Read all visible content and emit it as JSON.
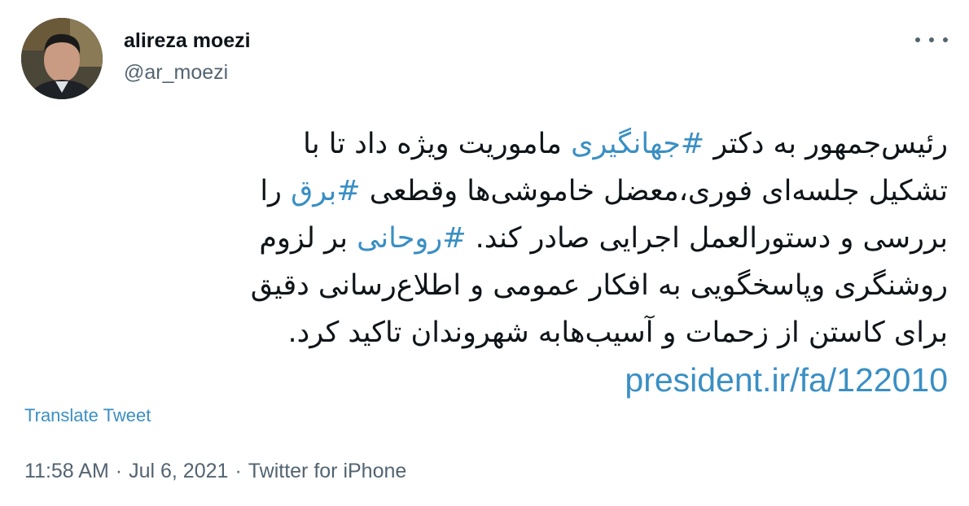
{
  "author": {
    "name": "alireza moezi",
    "handle": "@ar_moezi"
  },
  "tweet": {
    "lines": [
      [
        {
          "text": "رئیس‌جمهور به دکتر ",
          "tag": false
        },
        {
          "text": "#جهانگیری",
          "tag": true
        },
        {
          "text": " ماموریت ویژه داد تا با",
          "tag": false
        }
      ],
      [
        {
          "text": "تشکیل جلسه‌ای فوری،معضل خاموشی‌ها وقطعی ",
          "tag": false
        },
        {
          "text": "#برق",
          "tag": true
        },
        {
          "text": " را",
          "tag": false
        }
      ],
      [
        {
          "text": "بررسی و دستورالعمل اجرایی صادر کند. ",
          "tag": false
        },
        {
          "text": "#روحانی",
          "tag": true
        },
        {
          "text": " بر لزوم",
          "tag": false
        }
      ],
      [
        {
          "text": "روشنگری وپاسخگویی به افکار عمومی و اطلاع‌رسانی دقیق",
          "tag": false
        }
      ],
      [
        {
          "text": "برای کاستن از زحمات و آسیب‌هابه شهروندان تاکید کرد.",
          "tag": false
        }
      ]
    ],
    "link": "president.ir/fa/122010"
  },
  "translate_label": "Translate Tweet",
  "meta": {
    "time": "11:58 AM",
    "date": "Jul 6, 2021",
    "source": "Twitter for iPhone",
    "separator": "·"
  },
  "colors": {
    "link": "#3a8fc4",
    "text": "#0f1419",
    "muted": "#536471"
  },
  "icons": {
    "more": "more-options-icon"
  }
}
